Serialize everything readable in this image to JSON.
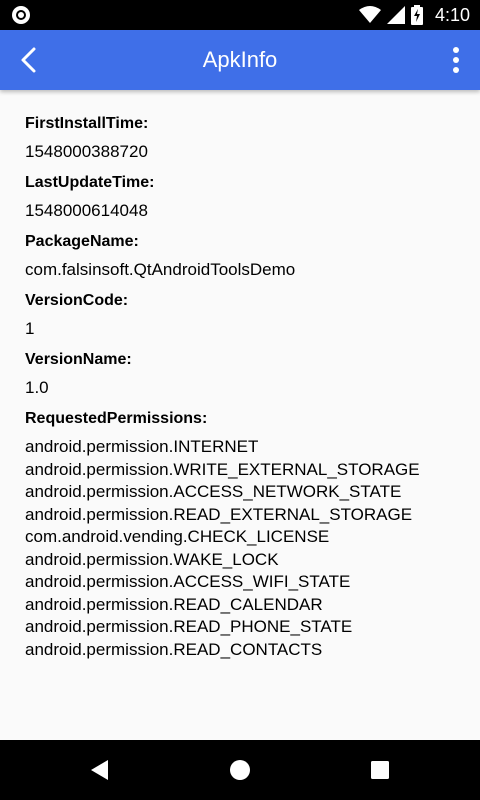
{
  "status_bar": {
    "time": "4:10",
    "icons": [
      "circle-notification-icon",
      "wifi-icon",
      "signal-icon",
      "battery-charging-icon"
    ]
  },
  "app_bar": {
    "title": "ApkInfo",
    "color": "#3f6fe8",
    "back_icon": "chevron-left-icon",
    "menu_icon": "more-vertical-icon"
  },
  "fields": [
    {
      "label": "FirstInstallTime:",
      "value": "1548000388720"
    },
    {
      "label": "LastUpdateTime:",
      "value": "1548000614048"
    },
    {
      "label": "PackageName:",
      "value": "com.falsinsoft.QtAndroidToolsDemo"
    },
    {
      "label": "VersionCode:",
      "value": "1"
    },
    {
      "label": "VersionName:",
      "value": "1.0"
    }
  ],
  "permissions": {
    "label": "RequestedPermissions:",
    "items": [
      "android.permission.INTERNET",
      "android.permission.WRITE_EXTERNAL_STORAGE",
      "android.permission.ACCESS_NETWORK_STATE",
      "android.permission.READ_EXTERNAL_STORAGE",
      "com.android.vending.CHECK_LICENSE",
      "android.permission.WAKE_LOCK",
      "android.permission.ACCESS_WIFI_STATE",
      "android.permission.READ_CALENDAR",
      "android.permission.READ_PHONE_STATE",
      "android.permission.READ_CONTACTS"
    ]
  },
  "nav_bar": {
    "icons": [
      "back-triangle-icon",
      "home-circle-icon",
      "recents-square-icon"
    ]
  }
}
